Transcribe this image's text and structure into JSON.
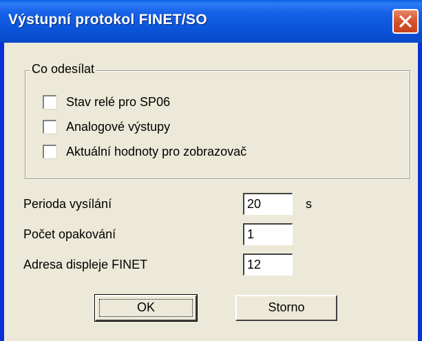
{
  "window": {
    "title": "Výstupní protokol FINET/SO"
  },
  "group": {
    "label": "Co odesílat",
    "checkboxes": [
      {
        "label": "Stav relé pro SP06",
        "checked": false
      },
      {
        "label": "Analogové výstupy",
        "checked": false
      },
      {
        "label": "Aktuální hodnoty pro zobrazovač",
        "checked": false
      }
    ]
  },
  "fields": {
    "perioda": {
      "label": "Perioda vysílání",
      "value": "20",
      "unit": "s"
    },
    "pocet": {
      "label": "Počet opakování",
      "value": "1"
    },
    "adresa": {
      "label": "Adresa displeje FINET",
      "value": "12"
    }
  },
  "buttons": {
    "ok": "OK",
    "storno": "Storno"
  },
  "colors": {
    "titlebar": "#0a53d8",
    "window_bg": "#ece9d8",
    "close_button": "#d8562e"
  }
}
